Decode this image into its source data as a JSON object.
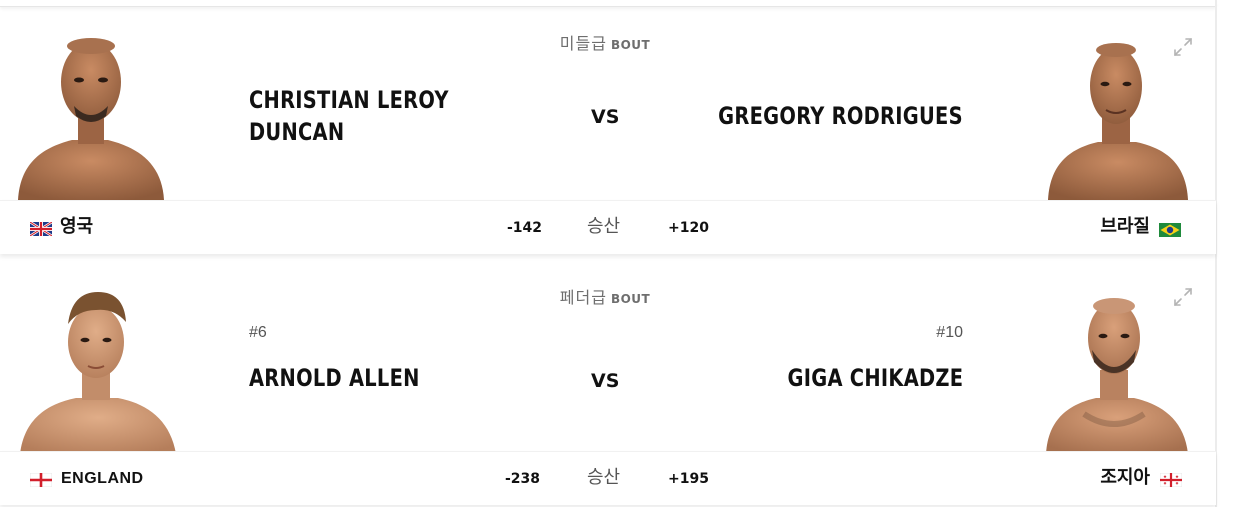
{
  "fights": [
    {
      "weight_class": "미들급",
      "bout_label": "BOUT",
      "vs_label": "VS",
      "odds_label": "승산",
      "red": {
        "name_line1": "CHRISTIAN LEROY",
        "name_line2": "DUNCAN",
        "rank": "",
        "country": "영국",
        "country_flag": "united-kingdom-flag",
        "odds": "-142"
      },
      "blue": {
        "name_line1": "GREGORY RODRIGUES",
        "rank": "",
        "country": "브라질",
        "country_flag": "brazil-flag",
        "odds": "+120"
      }
    },
    {
      "weight_class": "페더급",
      "bout_label": "BOUT",
      "vs_label": "VS",
      "odds_label": "승산",
      "red": {
        "name_line1": "ARNOLD ALLEN",
        "rank": "#6",
        "country": "ENGLAND",
        "country_flag": "england-flag",
        "odds": "-238"
      },
      "blue": {
        "name_line1": "GIGA CHIKADZE",
        "rank": "#10",
        "country": "조지아",
        "country_flag": "georgia-flag",
        "odds": "+195"
      }
    }
  ],
  "colors": {
    "text": "#111111",
    "muted": "#6e6e6e",
    "skin": "#c98b63",
    "brazil_green": "#1f8a3c",
    "brazil_yellow": "#f7d117",
    "uk_blue": "#1e3a8a",
    "cross_red": "#d21f2b"
  },
  "icons": [
    "expand-icon"
  ]
}
